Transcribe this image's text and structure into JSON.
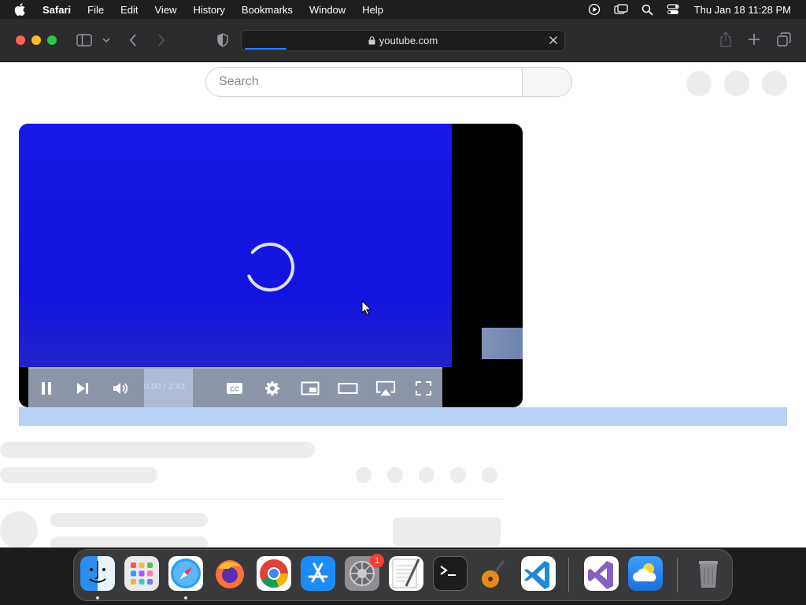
{
  "menubar": {
    "app": "Safari",
    "items": [
      "File",
      "Edit",
      "View",
      "History",
      "Bookmarks",
      "Window",
      "Help"
    ],
    "clock": "Thu Jan 18  11:28 PM"
  },
  "toolbar": {
    "url": "youtube.com",
    "load_progress": 0.13
  },
  "youtube": {
    "search_placeholder": "Search",
    "player": {
      "time": "0:00 / 2:43",
      "state": "loading"
    }
  },
  "dock": {
    "apps": [
      "Finder",
      "Launchpad",
      "Safari",
      "Firefox",
      "Chrome",
      "App Store",
      "System Settings",
      "TextEdit",
      "Terminal",
      "GarageBand",
      "Visual Studio Code",
      "Visual Studio",
      "Weather",
      "Trash"
    ],
    "settings_badge": "1"
  },
  "colors": {
    "video_blue": "#1818e8",
    "selection_blue": "#b7d2f7",
    "safari_progress": "#2f7ff7"
  }
}
